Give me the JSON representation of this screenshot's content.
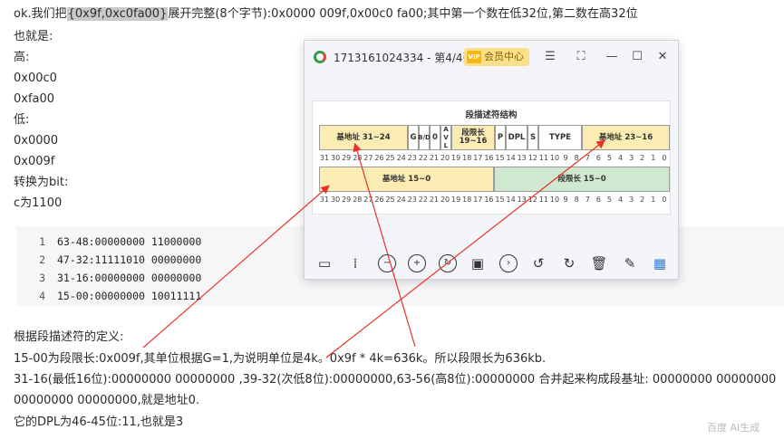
{
  "article": {
    "line1_pre": "ok.我们把",
    "line1_highlight": "{0x9f,0xc0fa00}",
    "line1_post": "展开完整(8个字节):0x0000 009f,0x00c0 fa00;其中第一个数在低32位,第二数在高32位",
    "also": "也就是:",
    "high_label": "高:",
    "high_val1": "0x00c0",
    "high_val2": "0xfa00",
    "low_label": "低:",
    "low_val1": "0x0000",
    "low_val2": "0x009f",
    "convert": "转换为bit:",
    "c_bits": "c为1100",
    "def_intro": "根据段描述符的定义:",
    "limit_line": "15-00为段限长:0x009f,其单位根据G=1,为说明单位是4k。0x9f * 4k=636k。所以段限长为636kb.",
    "base_line1": "31-16(最低16位):00000000 00000000 ,39-32(次低8位):00000000,63-56(高8位):00000000 合并起来构成段基址: 00000000 00000000",
    "base_line2": "00000000 00000000,就是地址0.",
    "dpl_line": "它的DPL为46-45位:11,也就是3"
  },
  "code_lines": [
    {
      "num": "1",
      "text": "63-48:00000000 11000000"
    },
    {
      "num": "2",
      "text": "47-32:11111010 00000000"
    },
    {
      "num": "3",
      "text": "31-16:00000000 00000000"
    },
    {
      "num": "4",
      "text": "15-00:00000000 10011111"
    }
  ],
  "viewer": {
    "title": "1713161024334 - 第4/4张",
    "vip_mark": "VIP",
    "vip_label": "会员中心",
    "controls": {
      "pin": "☰",
      "fullscreen": "⛶",
      "minimize": "—",
      "maximize": "☐",
      "close": "✕"
    },
    "diagram": {
      "title": "段描述符结构",
      "row1": [
        "基地址 31~24",
        "G",
        "B/D",
        "0",
        "A V L",
        "段限长 19~16",
        "P",
        "DPL",
        "S",
        "TYPE",
        "基地址 23~16"
      ],
      "row1_bits": [
        "31",
        "30",
        "29",
        "28",
        "27",
        "26",
        "25",
        "24",
        "23",
        "22",
        "21",
        "20",
        "19",
        "18",
        "17",
        "16",
        "15",
        "14",
        "13",
        "12",
        "11",
        "10",
        "9",
        "8",
        "7",
        "6",
        "5",
        "4",
        "3",
        "2",
        "1",
        "0"
      ],
      "row2": [
        "基地址 15~0",
        "段限长 15~0"
      ],
      "row2_bits": [
        "31",
        "30",
        "29",
        "28",
        "27",
        "26",
        "25",
        "24",
        "23",
        "22",
        "21",
        "20",
        "19",
        "18",
        "17",
        "16",
        "15",
        "14",
        "13",
        "12",
        "11",
        "10",
        "9",
        "8",
        "7",
        "6",
        "5",
        "4",
        "3",
        "2",
        "1",
        "0"
      ]
    },
    "tools": [
      "monitor-icon",
      "fit-icon",
      "zoom-out-icon",
      "zoom-in-icon",
      "rotate-icon",
      "slideshow-icon",
      "next-icon",
      "rotate-left-icon",
      "rotate-right-icon",
      "delete-icon",
      "edit-icon",
      "grid-icon"
    ]
  },
  "watermark": "百度 AI生成",
  "colors": {
    "arrow": "#e8322b",
    "yellow_cell": "#fbecb4",
    "green_cell": "#cfe8cf",
    "highlight": "#c9c9c9"
  }
}
